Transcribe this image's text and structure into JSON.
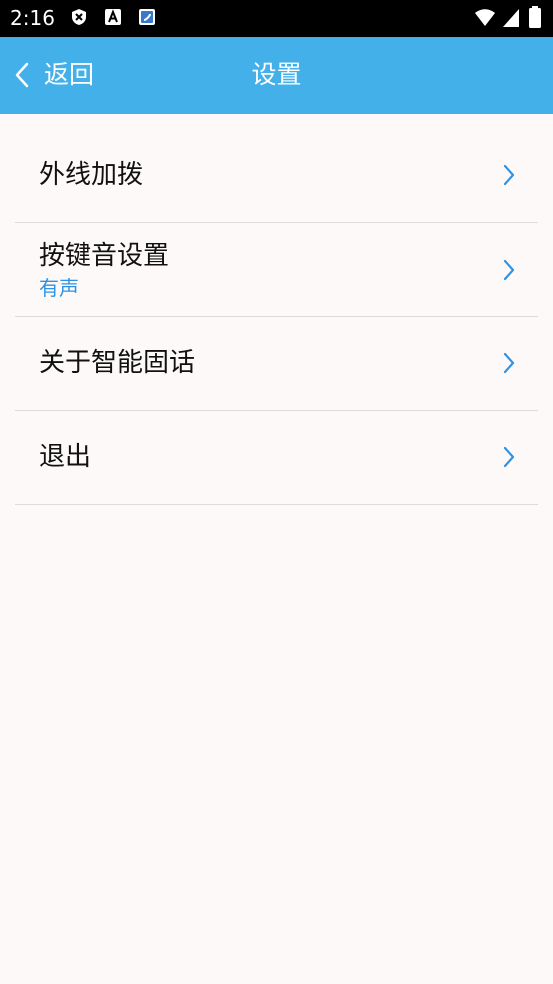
{
  "status_bar": {
    "time": "2:16",
    "left_icons": [
      "shield-x-icon",
      "font-a-icon",
      "phone-app-icon"
    ],
    "right_icons": [
      "wifi-icon",
      "cellular-signal-icon",
      "battery-icon"
    ]
  },
  "header": {
    "back_label": "返回",
    "title": "设置",
    "background_color": "#44b0e9"
  },
  "settings": {
    "items": [
      {
        "title": "外线加拨",
        "subtitle": ""
      },
      {
        "title": "按键音设置",
        "subtitle": "有声"
      },
      {
        "title": "关于智能固话",
        "subtitle": ""
      },
      {
        "title": "退出",
        "subtitle": ""
      }
    ],
    "accent_color": "#2f93e5"
  }
}
